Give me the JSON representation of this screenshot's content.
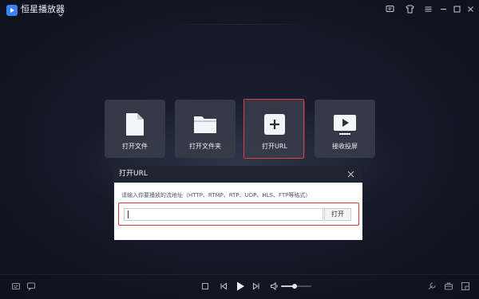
{
  "app": {
    "title": "恒星播放器",
    "logo_icon": "app-logo-icon",
    "accent": "#3b82f6"
  },
  "window_controls": [
    "feedback-icon",
    "skin-icon",
    "menu-icon",
    "minimize-icon",
    "maximize-icon",
    "close-icon"
  ],
  "tiles": [
    {
      "label": "打开文件",
      "icon": "file-icon"
    },
    {
      "label": "打开文件夹",
      "icon": "folder-icon"
    },
    {
      "label": "打开URL",
      "icon": "plus-icon",
      "highlighted": true
    },
    {
      "label": "接收投屏",
      "icon": "screen-cast-icon"
    }
  ],
  "dialog": {
    "title": "打开URL",
    "hint": "请输入你要播放的流地址（HTTP、RTMP、RTP、UDP、HLS、FTP等格式）",
    "input_value": "",
    "open_button": "打开"
  },
  "bottom_bar": {
    "left_icons": [
      "subtitle-icon",
      "caption-icon"
    ],
    "center_icons": [
      "stop-icon",
      "previous-icon",
      "play-icon",
      "next-icon",
      "volume-icon"
    ],
    "right_icons": [
      "tools-icon",
      "toolbox-icon",
      "fullscreen-icon"
    ],
    "volume": 0.45
  },
  "colors": {
    "highlight": "#e0403f",
    "background": "#131826",
    "tile": "#363c4a"
  }
}
